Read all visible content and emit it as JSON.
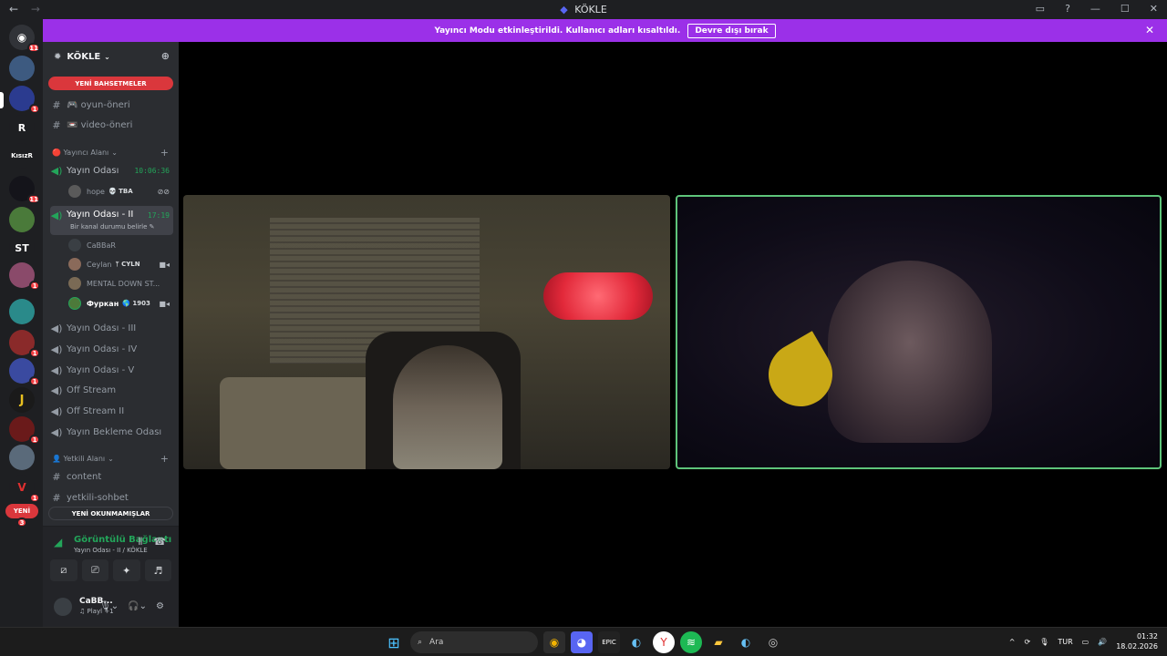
{
  "window": {
    "title": "KÖKLE",
    "nav_back": "←",
    "nav_fwd": "→"
  },
  "banner": {
    "text": "Yayıncı Modu etkinleştirildi. Kullanıcı adları kısaltıldı.",
    "button": "Devre dışı bırak",
    "close": "✕"
  },
  "guilds": [
    {
      "label": "",
      "badge": "11"
    },
    {
      "label": "",
      "badge": ""
    },
    {
      "label": "",
      "badge": "1"
    },
    {
      "label": "R",
      "badge": ""
    },
    {
      "label": "KısızR",
      "badge": ""
    },
    {
      "label": "",
      "badge": "11"
    },
    {
      "label": "",
      "badge": ""
    },
    {
      "label": "ST",
      "badge": ""
    },
    {
      "label": "",
      "badge": "1"
    },
    {
      "label": "",
      "badge": ""
    },
    {
      "label": "",
      "badge": "1"
    },
    {
      "label": "",
      "badge": "1"
    },
    {
      "label": "J",
      "badge": ""
    },
    {
      "label": "",
      "badge": "1"
    },
    {
      "label": "",
      "badge": ""
    },
    {
      "label": "",
      "badge": "1"
    }
  ],
  "new_guild_pill": {
    "label": "YENİ",
    "count": "3"
  },
  "server": {
    "name": "KÖKLE",
    "chevron": "⌄"
  },
  "mentions_pill": "YENİ BAHSETMELER",
  "unread_pill": "YENİ OKUNMAMIŞLAR",
  "channels_top": [
    {
      "icon": "#",
      "label": "🎮 oyun-öneri"
    },
    {
      "icon": "#",
      "label": "📼 video-öneri"
    }
  ],
  "category_streamer": "🔴 Yayıncı Alanı",
  "voice1": {
    "label": "Yayın Odası",
    "time": "10:06:36"
  },
  "voice1_user": {
    "name": "hope",
    "tag": "💀 TBA"
  },
  "voice2": {
    "label": "Yayın Odası - II",
    "time": "17:19",
    "sub": "Bir kanal durumu belirle ✎"
  },
  "voice2_users": [
    {
      "name": "CaBBaR",
      "tag": "",
      "color": "#3a3f44"
    },
    {
      "name": "Ceylan",
      "tag": "ᛘ CYLN",
      "color": "#8a6a5a"
    },
    {
      "name": "MENTAL DOWN ST...",
      "tag": "",
      "color": "#7a6a55"
    },
    {
      "name": "Фуркан",
      "tag": "🌎 1903",
      "color": "#4d7a3a"
    }
  ],
  "voice_channels": [
    "Yayın Odası - III",
    "Yayın Odası - IV",
    "Yayın Odası - V",
    "Off Stream",
    "Off Stream II",
    "Yayın Bekleme Odası"
  ],
  "category_staff": "👤 Yetkili Alanı",
  "staff_channels": [
    "content",
    "yetkili-sohbet"
  ],
  "voice_panel": {
    "title": "Görüntülü Bağlantı",
    "sub": "Yayın Odası - II / KÖKLE"
  },
  "me": {
    "name": "CaBB...",
    "status": "♫ Playl +1"
  },
  "taskbar": {
    "search_placeholder": "Ara",
    "lang": "TUR",
    "time": "01:32",
    "date": "18.02.2026"
  }
}
